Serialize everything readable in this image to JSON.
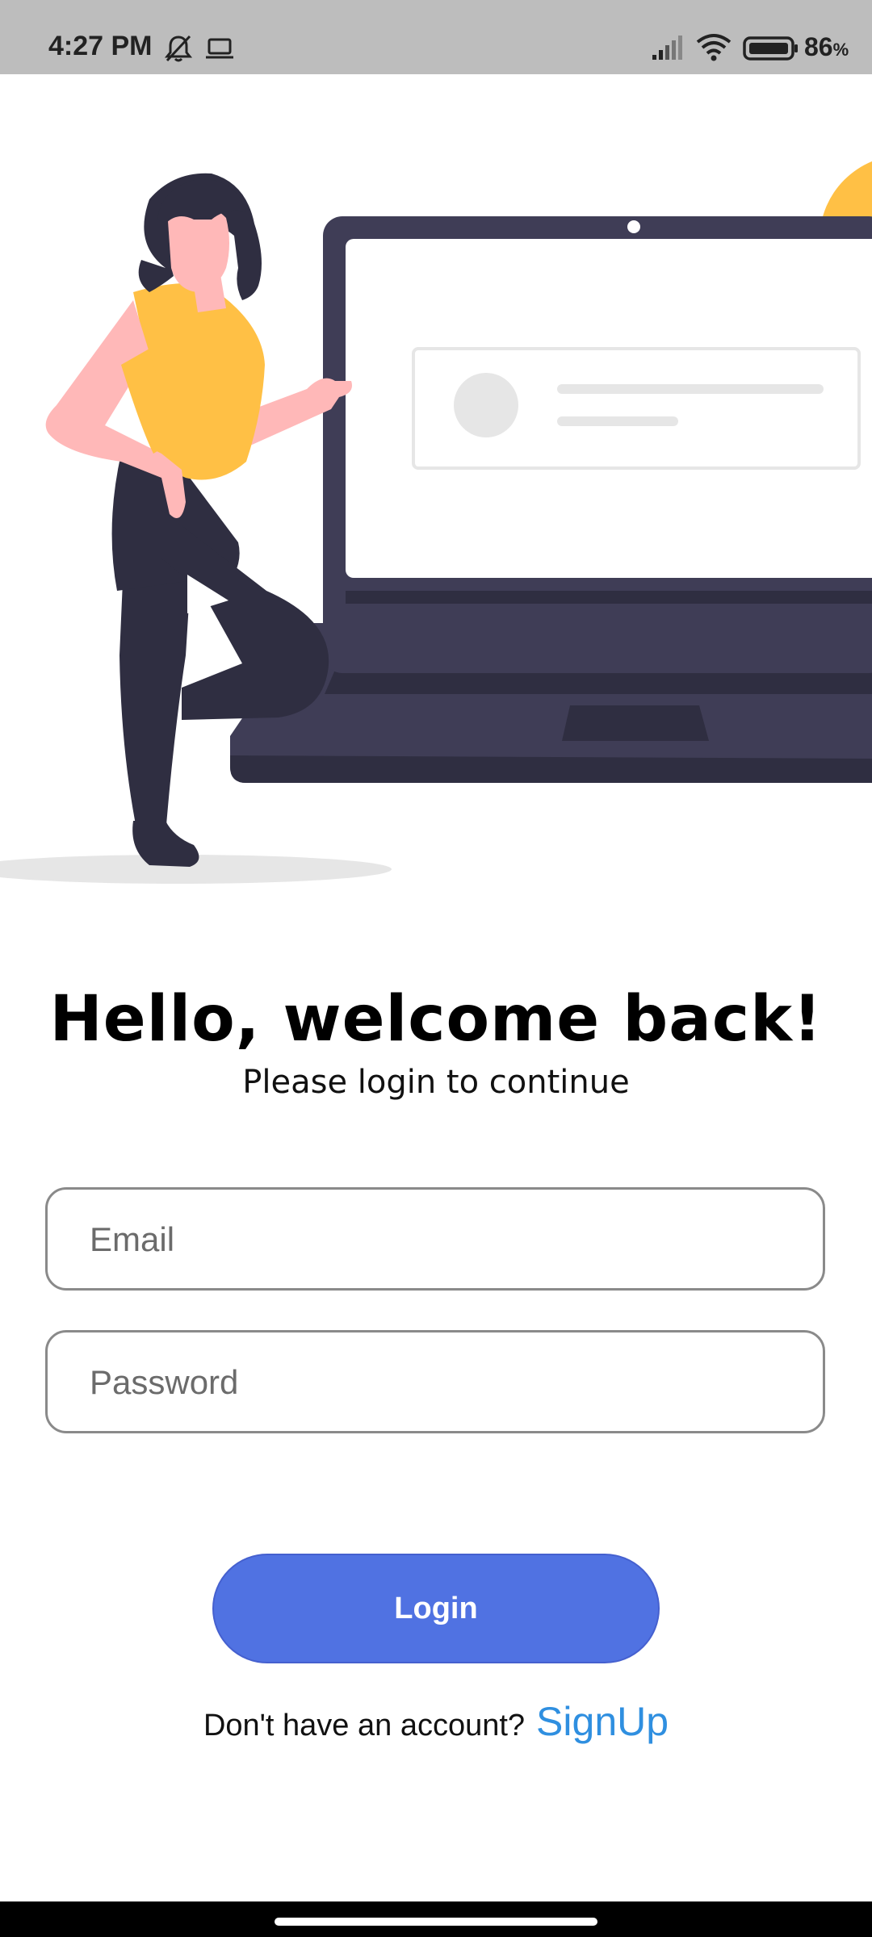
{
  "status_bar": {
    "time": "4:27 PM",
    "icons": [
      "bell-off-icon",
      "laptop-icon",
      "signal-icon",
      "wifi-icon",
      "battery-icon"
    ],
    "battery_level": "86",
    "battery_unit": "%"
  },
  "illustration": {
    "description_icon": "woman-with-laptop-illustration",
    "colors": {
      "laptop": "#3f3d56",
      "laptop_dark": "#2f2e41",
      "accent_yellow": "#ffc045",
      "skin": "#ffb8b8",
      "screen": "#ffffff",
      "card": "#e6e6e6"
    }
  },
  "header": {
    "title": "Hello, welcome back!",
    "subtitle": "Please login to continue"
  },
  "form": {
    "email_placeholder": "Email",
    "password_placeholder": "Password",
    "login_label": "Login"
  },
  "footer": {
    "prompt": "Don't have an account?",
    "signup_label": "SignUp"
  },
  "colors": {
    "primary": "#5072e2",
    "link": "#2f8fe0",
    "status_bar": "#bdbdbd"
  }
}
